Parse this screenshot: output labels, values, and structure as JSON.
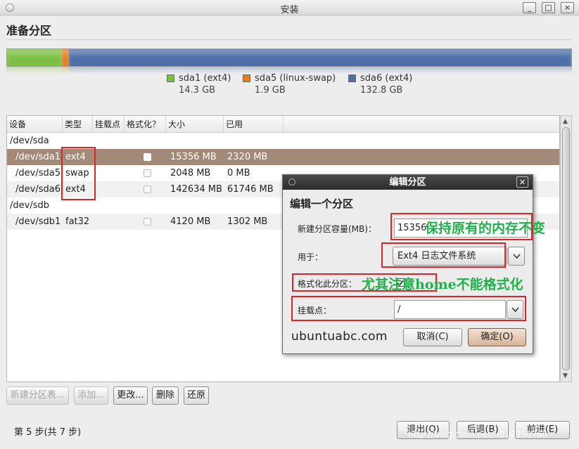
{
  "window": {
    "title": "安装",
    "controls": [
      "_",
      "□",
      "×"
    ]
  },
  "page": {
    "heading": "准备分区"
  },
  "partition_bar": {
    "segments": [
      {
        "name": "sda1 (ext4)",
        "size": "14.3 GB",
        "color": "#7bc043",
        "fraction": 0.0968
      },
      {
        "name": "sda5 (linux-swap)",
        "size": "1.9 GB",
        "color": "#e47d22",
        "fraction": 0.0129
      },
      {
        "name": "sda6 (ext4)",
        "size": "132.8 GB",
        "color": "#4d6fa7",
        "fraction": 0.8903
      }
    ]
  },
  "table": {
    "headers": [
      "设备",
      "类型",
      "挂载点",
      "格式化？",
      "大小",
      "已用"
    ],
    "rows": [
      {
        "device": "/dev/sda",
        "type": "",
        "mount": "",
        "format": null,
        "size": "",
        "used": ""
      },
      {
        "device": "/dev/sda1",
        "type": "ext4",
        "mount": "",
        "format": false,
        "size": "15356 MB",
        "used": "2320 MB"
      },
      {
        "device": "/dev/sda5",
        "type": "swap",
        "mount": "",
        "format": false,
        "size": "2048 MB",
        "used": "0 MB"
      },
      {
        "device": "/dev/sda6",
        "type": "ext4",
        "mount": "",
        "format": false,
        "size": "142634 MB",
        "used": "61746 MB"
      },
      {
        "device": "/dev/sdb",
        "type": "",
        "mount": "",
        "format": null,
        "size": "",
        "used": ""
      },
      {
        "device": "/dev/sdb1",
        "type": "fat32",
        "mount": "",
        "format": false,
        "size": "4120 MB",
        "used": "1302 MB"
      }
    ]
  },
  "table_buttons": {
    "new_table": "新建分区表...",
    "add": "添加...",
    "change": "更改...",
    "delete": "删除",
    "revert": "还原"
  },
  "footer": {
    "step": "第 5 步(共 7 步)",
    "quit": "退出(Q)",
    "back": "后退(B)",
    "forward": "前进(E)",
    "watermark": "http://blog.csdn.net/u010950780"
  },
  "dialog": {
    "title": "编辑分区",
    "close": "×",
    "heading": "编辑一个分区",
    "size_label": "新建分区容量(MB)：",
    "size_value": "15356",
    "use_label": "用于：",
    "use_value": "Ext4 日志文件系统",
    "format_label": "格式化此分区：",
    "format_checked": true,
    "mount_label": "挂载点：",
    "mount_value": "/",
    "brand": "ubuntuabc.com",
    "cancel": "取消(C)",
    "ok": "确定(O)"
  },
  "annotations": {
    "keep_size": "保持原有的内存不变",
    "home_note": "尤其注意home不能格式化"
  }
}
